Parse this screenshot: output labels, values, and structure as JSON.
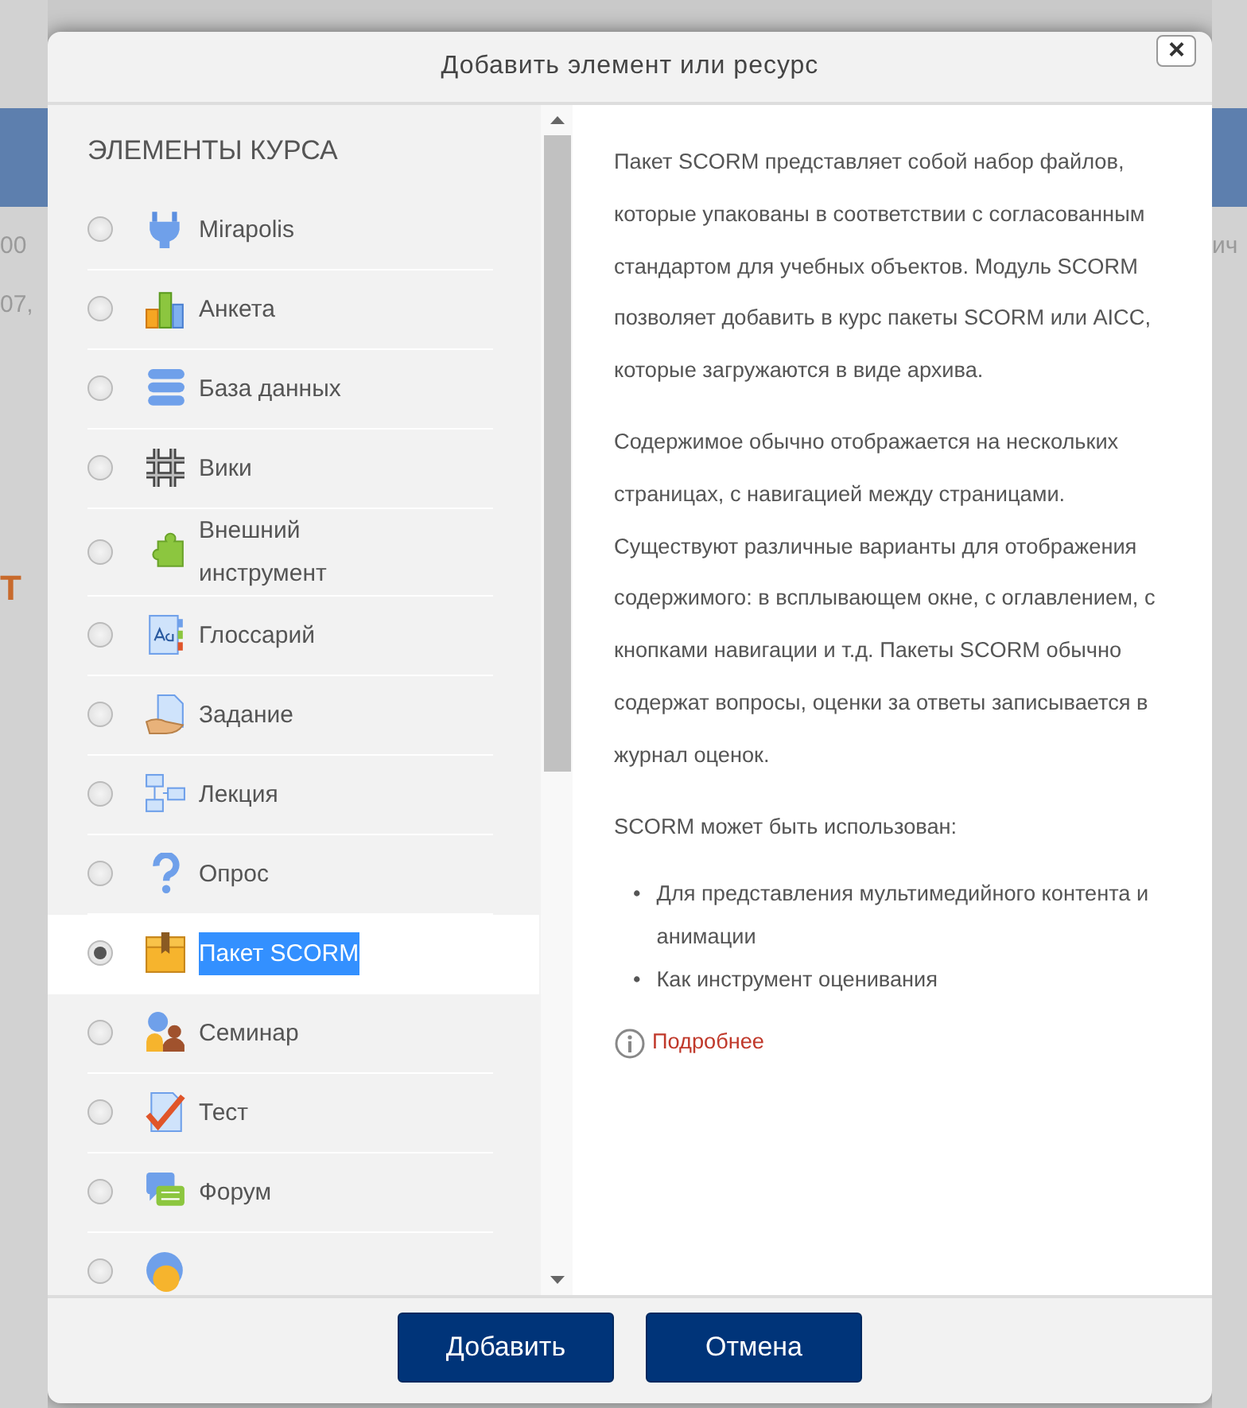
{
  "background": {
    "left_fragments": [
      "00",
      "07,",
      "T"
    ],
    "right_fragments": [
      "ич"
    ]
  },
  "dialog": {
    "title": "Добавить элемент или ресурс",
    "close": "×",
    "section_heading": "ЭЛЕМЕНТЫ КУРСА",
    "items": [
      {
        "kind": "plug",
        "label": "Mirapolis",
        "selected": false
      },
      {
        "kind": "bars",
        "label": "Анкета",
        "selected": false
      },
      {
        "kind": "database",
        "label": "База данных",
        "selected": false
      },
      {
        "kind": "wiki",
        "label": "Вики",
        "selected": false
      },
      {
        "kind": "puzzle",
        "label": "Внешний инструмент",
        "selected": false
      },
      {
        "kind": "glossary",
        "label": "Глоссарий",
        "selected": false
      },
      {
        "kind": "assignment",
        "label": "Задание",
        "selected": false
      },
      {
        "kind": "lesson",
        "label": "Лекция",
        "selected": false
      },
      {
        "kind": "question",
        "label": "Опрос",
        "selected": false
      },
      {
        "kind": "package",
        "label": "Пакет SCORM",
        "selected": true
      },
      {
        "kind": "people",
        "label": "Семинар",
        "selected": false
      },
      {
        "kind": "quiz",
        "label": "Тест",
        "selected": false
      },
      {
        "kind": "forum",
        "label": "Форум",
        "selected": false
      },
      {
        "kind": "chat",
        "selected": false
      }
    ],
    "description": {
      "paragraphs": [
        "Пакет SCORM представляет собой набор файлов, которые упакованы в соответствии с согласованным стандартом для учебных объектов. Модуль SCORM позволяет добавить в курс пакеты SCORM или AICC, которые загружаются в виде архива.",
        "Содержимое обычно отображается на нескольких страницах, с навигацией между страницами. Существуют различные варианты для отображения содержимого: в всплывающем окне, с оглавлением, с кнопками навигации и т.д. Пакеты SCORM обычно содержат вопросы, оценки за ответы записывается в журнал оценок.",
        "SCORM может быть использован:"
      ],
      "bullet_marker": "•",
      "bullets": [
        "Для представления мультимедийного контента и анимации",
        "Как инструмент оценивания"
      ],
      "more_link": "Подробнее"
    },
    "buttons": [
      "Добавить",
      "Отмена"
    ]
  }
}
